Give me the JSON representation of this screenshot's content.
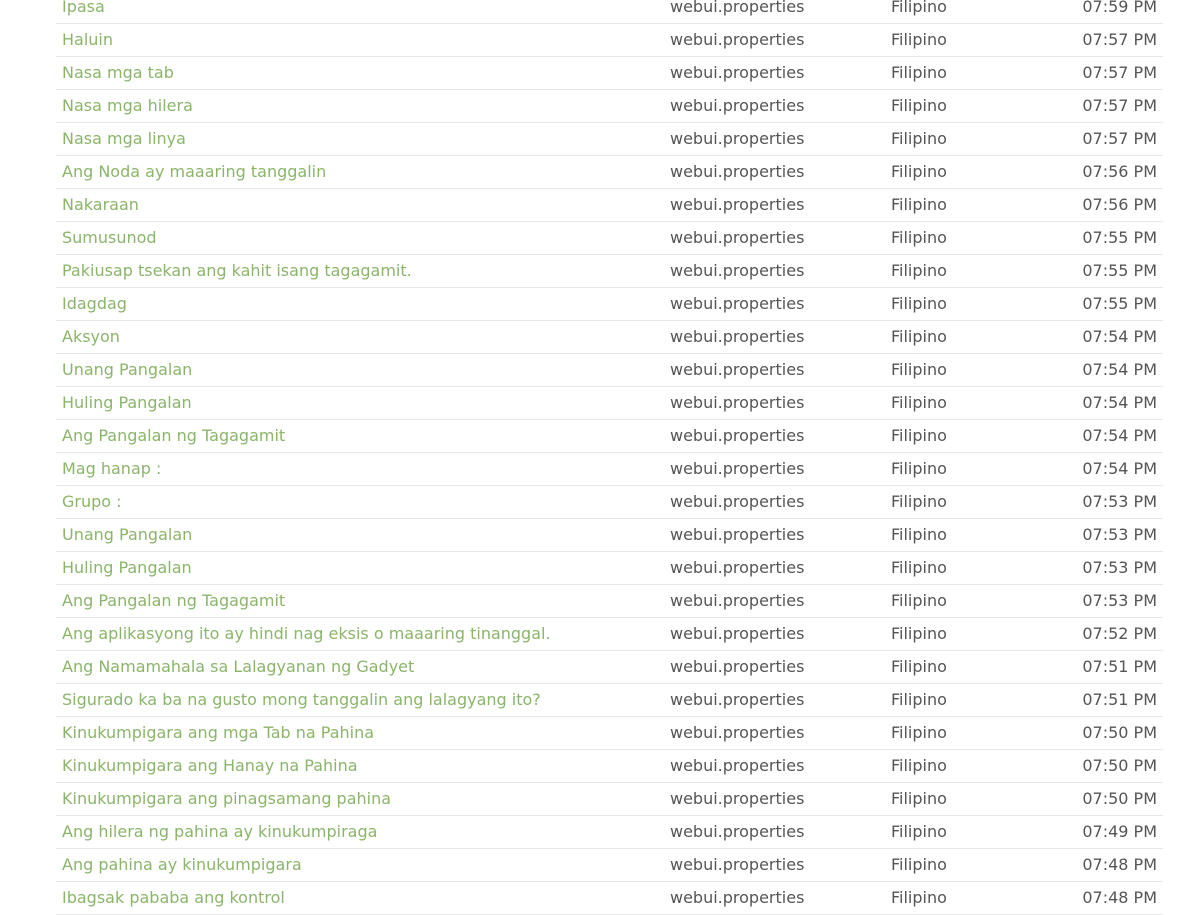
{
  "rows": [
    {
      "text": "Ipasa",
      "file": "webui.properties",
      "language": "Filipino",
      "time": "07:59 PM"
    },
    {
      "text": "Haluin",
      "file": "webui.properties",
      "language": "Filipino",
      "time": "07:57 PM"
    },
    {
      "text": "Nasa mga tab",
      "file": "webui.properties",
      "language": "Filipino",
      "time": "07:57 PM"
    },
    {
      "text": "Nasa mga hilera",
      "file": "webui.properties",
      "language": "Filipino",
      "time": "07:57 PM"
    },
    {
      "text": "Nasa mga linya",
      "file": "webui.properties",
      "language": "Filipino",
      "time": "07:57 PM"
    },
    {
      "text": "Ang Noda ay maaaring tanggalin",
      "file": "webui.properties",
      "language": "Filipino",
      "time": "07:56 PM"
    },
    {
      "text": "Nakaraan",
      "file": "webui.properties",
      "language": "Filipino",
      "time": "07:56 PM"
    },
    {
      "text": "Sumusunod",
      "file": "webui.properties",
      "language": "Filipino",
      "time": "07:55 PM"
    },
    {
      "text": "Pakiusap tsekan ang kahit isang tagagamit.",
      "file": "webui.properties",
      "language": "Filipino",
      "time": "07:55 PM"
    },
    {
      "text": "Idagdag",
      "file": "webui.properties",
      "language": "Filipino",
      "time": "07:55 PM"
    },
    {
      "text": "Aksyon",
      "file": "webui.properties",
      "language": "Filipino",
      "time": "07:54 PM"
    },
    {
      "text": "Unang Pangalan",
      "file": "webui.properties",
      "language": "Filipino",
      "time": "07:54 PM"
    },
    {
      "text": "Huling Pangalan",
      "file": "webui.properties",
      "language": "Filipino",
      "time": "07:54 PM"
    },
    {
      "text": "Ang Pangalan ng Tagagamit",
      "file": "webui.properties",
      "language": "Filipino",
      "time": "07:54 PM"
    },
    {
      "text": "Mag hanap :",
      "file": "webui.properties",
      "language": "Filipino",
      "time": "07:54 PM"
    },
    {
      "text": "Grupo :",
      "file": "webui.properties",
      "language": "Filipino",
      "time": "07:53 PM"
    },
    {
      "text": "Unang Pangalan",
      "file": "webui.properties",
      "language": "Filipino",
      "time": "07:53 PM"
    },
    {
      "text": "Huling Pangalan",
      "file": "webui.properties",
      "language": "Filipino",
      "time": "07:53 PM"
    },
    {
      "text": "Ang Pangalan ng Tagagamit",
      "file": "webui.properties",
      "language": "Filipino",
      "time": "07:53 PM"
    },
    {
      "text": "Ang aplikasyong ito ay hindi nag eksis o maaaring tinanggal.",
      "file": "webui.properties",
      "language": "Filipino",
      "time": "07:52 PM"
    },
    {
      "text": "Ang Namamahala sa Lalagyanan ng Gadyet",
      "file": "webui.properties",
      "language": "Filipino",
      "time": "07:51 PM"
    },
    {
      "text": "Sigurado ka ba na gusto mong tanggalin ang lalagyang ito?",
      "file": "webui.properties",
      "language": "Filipino",
      "time": "07:51 PM"
    },
    {
      "text": "Kinukumpigara ang mga Tab na Pahina",
      "file": "webui.properties",
      "language": "Filipino",
      "time": "07:50 PM"
    },
    {
      "text": "Kinukumpigara ang Hanay na Pahina",
      "file": "webui.properties",
      "language": "Filipino",
      "time": "07:50 PM"
    },
    {
      "text": "Kinukumpigara ang pinagsamang pahina",
      "file": "webui.properties",
      "language": "Filipino",
      "time": "07:50 PM"
    },
    {
      "text": "Ang hilera ng pahina ay kinukumpiraga",
      "file": "webui.properties",
      "language": "Filipino",
      "time": "07:49 PM"
    },
    {
      "text": "Ang pahina ay kinukumpigara",
      "file": "webui.properties",
      "language": "Filipino",
      "time": "07:48 PM"
    },
    {
      "text": "Ibagsak pababa ang kontrol",
      "file": "webui.properties",
      "language": "Filipino",
      "time": "07:48 PM"
    }
  ]
}
